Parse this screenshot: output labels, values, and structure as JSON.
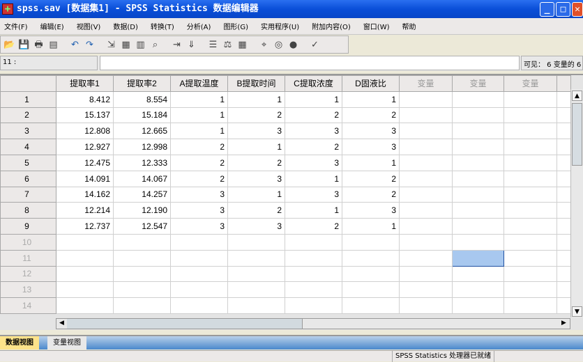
{
  "window": {
    "title": "spss.sav [数据集1] - SPSS Statistics 数据编辑器"
  },
  "menu": [
    "文件(F)",
    "编辑(E)",
    "视图(V)",
    "数据(D)",
    "转换(T)",
    "分析(A)",
    "图形(G)",
    "实用程序(U)",
    "附加内容(O)",
    "窗口(W)",
    "帮助"
  ],
  "toolbar": [
    "open-icon",
    "save-icon",
    "print-icon",
    "dialog-recall-icon",
    "undo-icon",
    "redo-icon",
    "goto-case-icon",
    "goto-variable-icon",
    "variables-icon",
    "find-icon",
    "insert-cases-icon",
    "insert-variable-icon",
    "split-file-icon",
    "weight-cases-icon",
    "select-cases-icon",
    "value-labels-icon",
    "use-sets-icon",
    "show-all-icon",
    "spell-check-icon"
  ],
  "editor": {
    "cell_ref": "11 :",
    "cell_value": "",
    "visible": "可见： 6 变量的 6"
  },
  "grid": {
    "columns": [
      "提取率1",
      "提取率2",
      "A提取温度",
      "B提取时间",
      "C提取浓度",
      "D固液比",
      "变量",
      "变量",
      "变量"
    ],
    "rows": [
      [
        "1",
        "8.412",
        "8.554",
        "1",
        "1",
        "1",
        "1"
      ],
      [
        "2",
        "15.137",
        "15.184",
        "1",
        "2",
        "2",
        "2"
      ],
      [
        "3",
        "12.808",
        "12.665",
        "1",
        "3",
        "3",
        "3"
      ],
      [
        "4",
        "12.927",
        "12.998",
        "2",
        "1",
        "2",
        "3"
      ],
      [
        "5",
        "12.475",
        "12.333",
        "2",
        "2",
        "3",
        "1"
      ],
      [
        "6",
        "14.091",
        "14.067",
        "2",
        "3",
        "1",
        "2"
      ],
      [
        "7",
        "14.162",
        "14.257",
        "3",
        "1",
        "3",
        "2"
      ],
      [
        "8",
        "12.214",
        "12.190",
        "3",
        "2",
        "1",
        "3"
      ],
      [
        "9",
        "12.737",
        "12.547",
        "3",
        "3",
        "2",
        "1"
      ]
    ],
    "empty_rows": [
      "10",
      "11",
      "12",
      "13",
      "14"
    ]
  },
  "tabs": {
    "data_view": "数据视图",
    "variable_view": "变量视图"
  },
  "status": "SPSS Statistics  处理器已就绪"
}
